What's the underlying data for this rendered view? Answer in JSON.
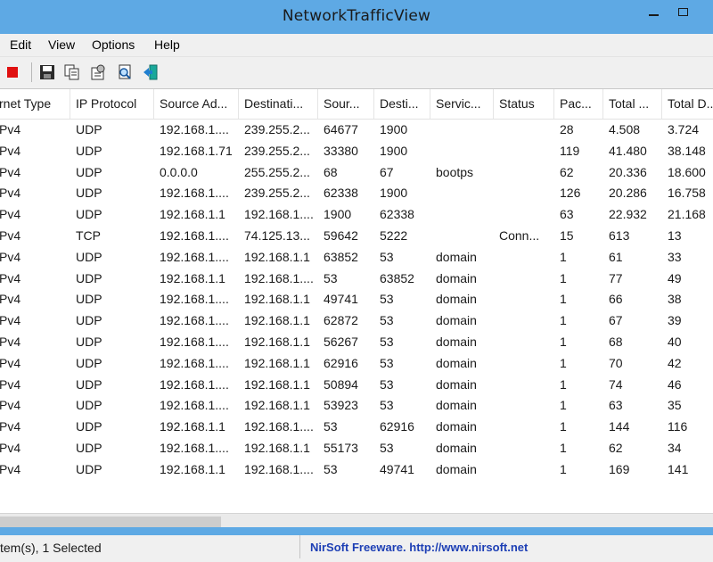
{
  "window": {
    "title": "NetworkTrafficView"
  },
  "menu": [
    {
      "label": "Edit"
    },
    {
      "label": "View"
    },
    {
      "label": "Options"
    },
    {
      "label": "Help"
    }
  ],
  "toolbar": {
    "icons": [
      "stop-icon",
      "save-icon",
      "copy-icon",
      "properties-icon",
      "find-icon",
      "exit-icon"
    ]
  },
  "columns": [
    "rnet Type",
    "IP Protocol",
    "Source Ad...",
    "Destinati...",
    "Sour...",
    "Desti...",
    "Servic...",
    "Status",
    "Pac...",
    "Total ...",
    "Total D..."
  ],
  "rows": [
    [
      "Pv4",
      "UDP",
      "192.168.1....",
      "239.255.2...",
      "64677",
      "1900",
      "",
      "",
      "28",
      "4.508",
      "3.724"
    ],
    [
      "Pv4",
      "UDP",
      "192.168.1.71",
      "239.255.2...",
      "33380",
      "1900",
      "",
      "",
      "119",
      "41.480",
      "38.148"
    ],
    [
      "Pv4",
      "UDP",
      "0.0.0.0",
      "255.255.2...",
      "68",
      "67",
      "bootps",
      "",
      "62",
      "20.336",
      "18.600"
    ],
    [
      "Pv4",
      "UDP",
      "192.168.1....",
      "239.255.2...",
      "62338",
      "1900",
      "",
      "",
      "126",
      "20.286",
      "16.758"
    ],
    [
      "Pv4",
      "UDP",
      "192.168.1.1",
      "192.168.1....",
      "1900",
      "62338",
      "",
      "",
      "63",
      "22.932",
      "21.168"
    ],
    [
      "Pv4",
      "TCP",
      "192.168.1....",
      "74.125.13...",
      "59642",
      "5222",
      "",
      "Conn...",
      "15",
      "613",
      "13"
    ],
    [
      "Pv4",
      "UDP",
      "192.168.1....",
      "192.168.1.1",
      "63852",
      "53",
      "domain",
      "",
      "1",
      "61",
      "33"
    ],
    [
      "Pv4",
      "UDP",
      "192.168.1.1",
      "192.168.1....",
      "53",
      "63852",
      "domain",
      "",
      "1",
      "77",
      "49"
    ],
    [
      "Pv4",
      "UDP",
      "192.168.1....",
      "192.168.1.1",
      "49741",
      "53",
      "domain",
      "",
      "1",
      "66",
      "38"
    ],
    [
      "Pv4",
      "UDP",
      "192.168.1....",
      "192.168.1.1",
      "62872",
      "53",
      "domain",
      "",
      "1",
      "67",
      "39"
    ],
    [
      "Pv4",
      "UDP",
      "192.168.1....",
      "192.168.1.1",
      "56267",
      "53",
      "domain",
      "",
      "1",
      "68",
      "40"
    ],
    [
      "Pv4",
      "UDP",
      "192.168.1....",
      "192.168.1.1",
      "62916",
      "53",
      "domain",
      "",
      "1",
      "70",
      "42"
    ],
    [
      "Pv4",
      "UDP",
      "192.168.1....",
      "192.168.1.1",
      "50894",
      "53",
      "domain",
      "",
      "1",
      "74",
      "46"
    ],
    [
      "Pv4",
      "UDP",
      "192.168.1....",
      "192.168.1.1",
      "53923",
      "53",
      "domain",
      "",
      "1",
      "63",
      "35"
    ],
    [
      "Pv4",
      "UDP",
      "192.168.1.1",
      "192.168.1....",
      "53",
      "62916",
      "domain",
      "",
      "1",
      "144",
      "116"
    ],
    [
      "Pv4",
      "UDP",
      "192.168.1....",
      "192.168.1.1",
      "55173",
      "53",
      "domain",
      "",
      "1",
      "62",
      "34"
    ],
    [
      "Pv4",
      "UDP",
      "192.168.1.1",
      "192.168.1....",
      "53",
      "49741",
      "domain",
      "",
      "1",
      "169",
      "141"
    ]
  ],
  "status": {
    "items_text": "tem(s), 1 Selected",
    "link_text": "NirSoft Freeware.  http://www.nirsoft.net"
  },
  "colors": {
    "frame": "#5ea9e4",
    "link": "#1d3fb5"
  }
}
